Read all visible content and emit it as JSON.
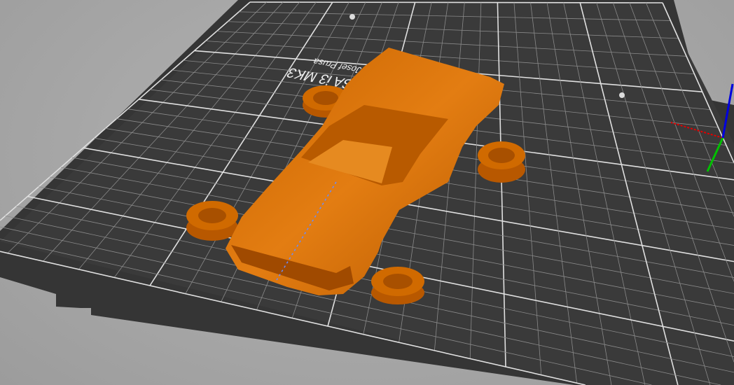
{
  "bed": {
    "label_model": "PRUSA i3 MK3",
    "label_author": "by Josef Prusa",
    "label_author_top": "Josef Prusa"
  },
  "colors": {
    "model": "#d06a00",
    "bed": "#373737",
    "grid": "#bdbdbd",
    "axis_x": "#e00000",
    "axis_y": "#00c000",
    "axis_z": "#0000e0"
  }
}
